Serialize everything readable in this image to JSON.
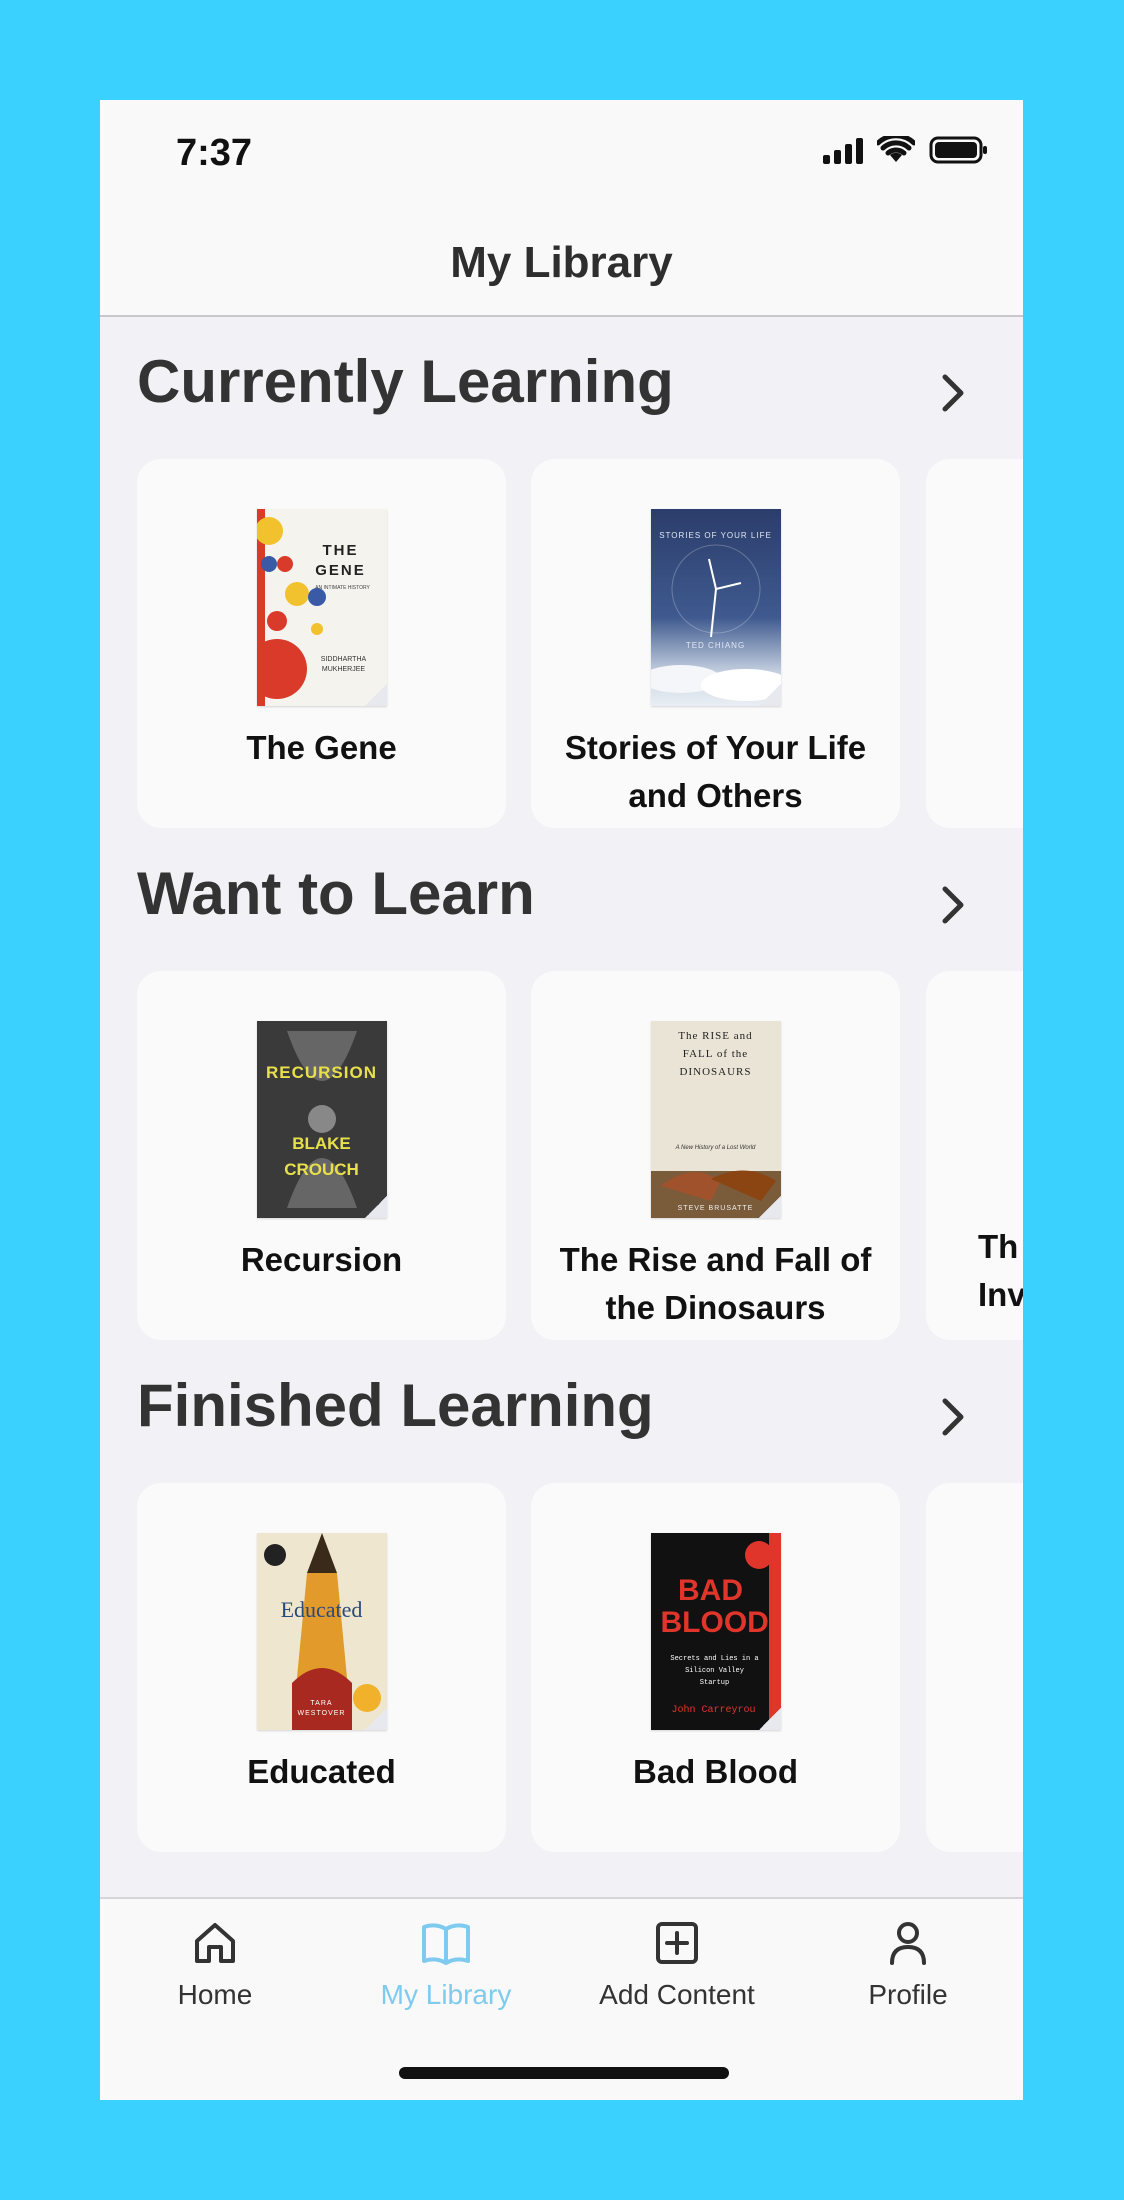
{
  "status_bar": {
    "time": "7:37"
  },
  "header": {
    "title": "My Library"
  },
  "sections": [
    {
      "title": "Currently Learning",
      "books": [
        {
          "title": "The Gene",
          "cover": {
            "headline": "THE GENE",
            "subtitle": "AN INTIMATE HISTORY",
            "author": "SIDDHARTHA MUKHERJEE"
          }
        },
        {
          "title": "Stories of Your Life and Others",
          "cover": {
            "headline": "STORIES OF YOUR LIFE",
            "author": "TED CHIANG"
          }
        }
      ]
    },
    {
      "title": "Want to Learn",
      "books": [
        {
          "title": "Recursion",
          "cover": {
            "headline": "RECURSION",
            "author": "BLAKE CROUCH"
          }
        },
        {
          "title": "The Rise and Fall of the Dinosaurs",
          "cover": {
            "headline": "The RISE and FALL of the DINOSAURS",
            "subtitle": "A New History of a Lost World",
            "author": "STEVE BRUSATTE"
          }
        },
        {
          "title": "Th Inv"
        }
      ]
    },
    {
      "title": "Finished Learning",
      "books": [
        {
          "title": "Educated",
          "cover": {
            "headline": "Educated",
            "author": "TARA WESTOVER"
          }
        },
        {
          "title": "Bad Blood",
          "cover": {
            "headline": "BAD BLOOD",
            "subtitle": "Secrets and Lies in a Silicon Valley Startup",
            "author": "John Carreyrou"
          }
        }
      ]
    }
  ],
  "tabbar": {
    "tabs": [
      {
        "label": "Home",
        "icon": "home-icon"
      },
      {
        "label": "My Library",
        "icon": "book-icon",
        "active": true
      },
      {
        "label": "Add Content",
        "icon": "plus-square-icon"
      },
      {
        "label": "Profile",
        "icon": "person-icon"
      }
    ]
  },
  "colors": {
    "accent": "#7fcbf0",
    "frame": "#3ad0ff"
  }
}
